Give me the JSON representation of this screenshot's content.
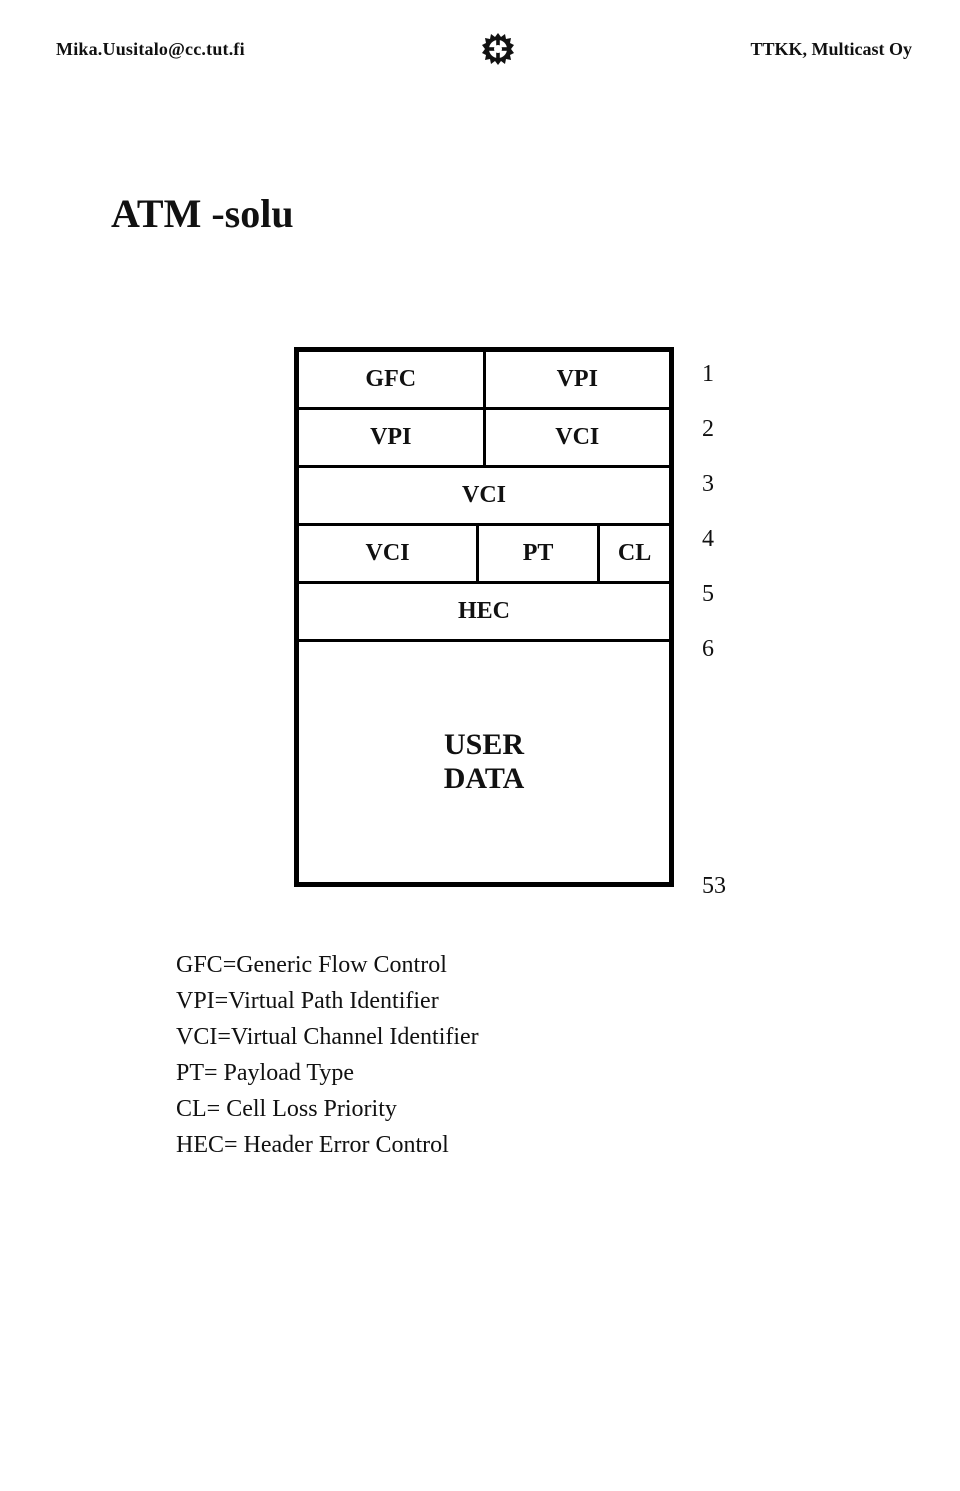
{
  "header": {
    "left": "Mika.Uusitalo@cc.tut.fi",
    "right": "TTKK, Multicast Oy",
    "logo_name": "gear-logo-icon"
  },
  "title": "ATM -solu",
  "cell": {
    "r1": {
      "a": "GFC",
      "b": "VPI",
      "n": "1"
    },
    "r2": {
      "a": "VPI",
      "b": "VCI",
      "n": "2"
    },
    "r3": {
      "a": "VCI",
      "n": "3"
    },
    "r4": {
      "a": "VCI",
      "b": "PT",
      "c": "CL",
      "n": "4"
    },
    "r5": {
      "a": "HEC",
      "n": "5"
    },
    "payload": {
      "l1": "USER",
      "l2": "DATA",
      "n_top": "6",
      "n_bottom": "53"
    }
  },
  "legend": [
    "GFC=Generic Flow Control",
    "VPI=Virtual Path Identifier",
    "VCI=Virtual Channel Identifier",
    "PT= Payload Type",
    "CL= Cell Loss Priority",
    "HEC= Header Error Control"
  ]
}
